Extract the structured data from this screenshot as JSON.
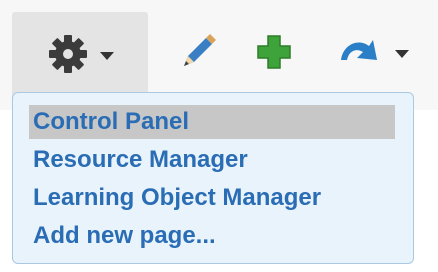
{
  "toolbar": {
    "icons": [
      "gear-icon",
      "pencil-icon",
      "plus-icon",
      "redo-arrow-icon"
    ],
    "colors": {
      "plus": "#3fa33b",
      "arrow": "#2a7fc7",
      "pencil": "#2f73b7"
    }
  },
  "menu": {
    "items": [
      {
        "label": "Control Panel",
        "highlighted": true
      },
      {
        "label": "Resource Manager"
      },
      {
        "label": "Learning Object Manager"
      },
      {
        "label": "Add new page..."
      }
    ],
    "link_color": "#2a6db5"
  }
}
